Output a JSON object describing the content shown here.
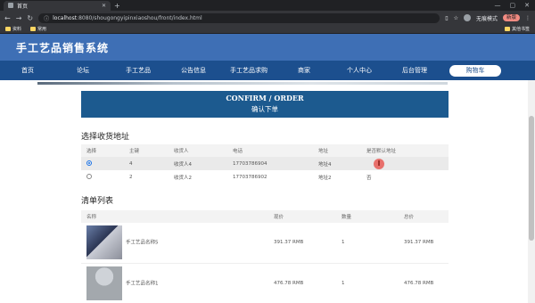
{
  "browser": {
    "tab_title": "首页",
    "url_host": "localhost",
    "url_path": ":8080/shougongyipinxiaoshou/front/index.html",
    "profile_label": "无痕模式",
    "update_label": "新版",
    "bookmarks": [
      "资料",
      "常用"
    ],
    "bookmarks_right": "其他书签"
  },
  "site": {
    "title": "手工艺品销售系统",
    "nav": [
      "首页",
      "论坛",
      "手工艺品",
      "公告信息",
      "手工艺品求购",
      "商家",
      "个人中心",
      "后台管理"
    ],
    "nav_active": "购物车"
  },
  "confirm": {
    "en": "CONFIRM / ORDER",
    "cn": "确认下单"
  },
  "address_section": {
    "title": "选择收货地址",
    "headers": [
      "选择",
      "主键",
      "收货人",
      "电话",
      "地址",
      "是否默认地址"
    ],
    "rows": [
      {
        "selected": true,
        "id": "4",
        "name": "收货人4",
        "phone": "17703786904",
        "address": "地址4",
        "default": ""
      },
      {
        "selected": false,
        "id": "2",
        "name": "收货人2",
        "phone": "17703786902",
        "address": "地址2",
        "default": "否"
      }
    ]
  },
  "cart_section": {
    "title": "清单列表",
    "headers": [
      "名称",
      "",
      "现价",
      "数量",
      "总价"
    ],
    "rows": [
      {
        "name": "手工艺品名称5",
        "price": "391.37 RMB",
        "qty": "1",
        "total": "391.37 RMB"
      },
      {
        "name": "手工艺品名称1",
        "price": "476.78 RMB",
        "qty": "1",
        "total": "476.78 RMB"
      }
    ]
  },
  "colors": {
    "header": "#3e6fb5",
    "nav": "#1c4f8e",
    "confirm": "#1c5a8f"
  }
}
